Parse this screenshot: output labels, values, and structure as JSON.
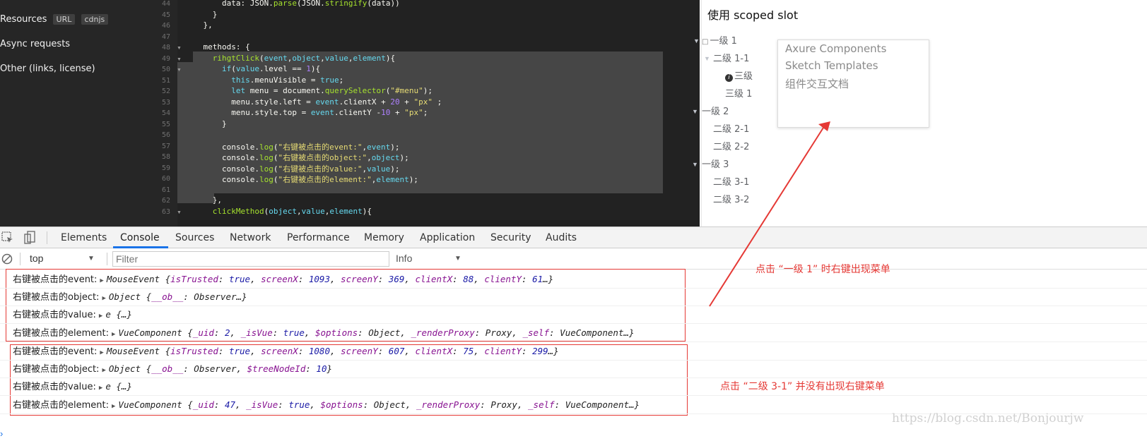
{
  "sidebar": {
    "resources": "Resources",
    "url_tag": "URL",
    "cdnjs_tag": "cdnjs",
    "async": "Async requests",
    "other": "Other (links, license)"
  },
  "editor": {
    "line_numbers": [
      "44",
      "45",
      "46",
      "47",
      "48",
      "49",
      "50",
      "51",
      "52",
      "53",
      "54",
      "55",
      "56",
      "57",
      "58",
      "59",
      "60",
      "61",
      "62",
      "63"
    ],
    "lines": [
      "        data: JSON.parse(JSON.stringify(data))",
      "      }",
      "    },",
      "",
      "    methods: {",
      "      rihgtClick(event,object,value,element){",
      "        if(value.level == 1){",
      "          this.menuVisible = true;",
      "          let menu = document.querySelector(\"#menu\");",
      "          menu.style.left = event.clientX + 20 + \"px\" ;",
      "          menu.style.top = event.clientY -10 + \"px\";",
      "        }",
      "",
      "        console.log(\"右键被点击的event:\",event);",
      "        console.log(\"右键被点击的object:\",object);",
      "        console.log(\"右键被点击的value:\",value);",
      "        console.log(\"右键被点击的element:\",element);",
      "",
      "      },",
      "      clickMethod(object,value,element){"
    ]
  },
  "preview": {
    "title": "使用 scoped slot",
    "tree": [
      {
        "label": "一级 1"
      },
      {
        "label": "二级 1-1"
      },
      {
        "label": "三级"
      },
      {
        "label": "三级 1"
      },
      {
        "label": "一级 2"
      },
      {
        "label": "二级 2-1"
      },
      {
        "label": "二级 2-2"
      },
      {
        "label": "一级 3"
      },
      {
        "label": "二级 3-1"
      },
      {
        "label": "二级 3-2"
      }
    ],
    "menu": [
      "Axure Components",
      "Sketch Templates",
      "组件交互文档"
    ]
  },
  "devtools": {
    "tabs": [
      "Elements",
      "Console",
      "Sources",
      "Network",
      "Performance",
      "Memory",
      "Application",
      "Security",
      "Audits"
    ],
    "active_tab": "Console",
    "context": "top",
    "filter_placeholder": "Filter",
    "level": "Info",
    "logs": [
      {
        "label": "右键被点击的event:",
        "type": "MouseEvent",
        "body": "{isTrusted: true, screenX: 1093, screenY: 369, clientX: 88, clientY: 61…}"
      },
      {
        "label": "右键被点击的object:",
        "type": "Object",
        "body": "{__ob__: Observer…}"
      },
      {
        "label": "右键被点击的value:",
        "type": "e",
        "body": "{…}"
      },
      {
        "label": "右键被点击的element:",
        "type": "VueComponent",
        "body": "{_uid: 2, _isVue: true, $options: Object, _renderProxy: Proxy, _self: VueComponent…}"
      },
      {
        "label": "右键被点击的event:",
        "type": "MouseEvent",
        "body": "{isTrusted: true, screenX: 1080, screenY: 607, clientX: 75, clientY: 299…}"
      },
      {
        "label": "右键被点击的object:",
        "type": "Object",
        "body": "{__ob__: Observer, $treeNodeId: 10}"
      },
      {
        "label": "右键被点击的value:",
        "type": "e",
        "body": "{…}"
      },
      {
        "label": "右键被点击的element:",
        "type": "VueComponent",
        "body": "{_uid: 47, _isVue: true, $options: Object, _renderProxy: Proxy, _self: VueComponent…}"
      }
    ]
  },
  "annotations": {
    "note1": "点击 “一级 1” 时右键出现菜单",
    "note2": "点击 “二级 3-1” 并没有出现右键菜单",
    "watermark": "https://blog.csdn.net/Bonjourjw"
  },
  "colors": {
    "accent": "#1a73e8",
    "annotation": "#e53935"
  }
}
